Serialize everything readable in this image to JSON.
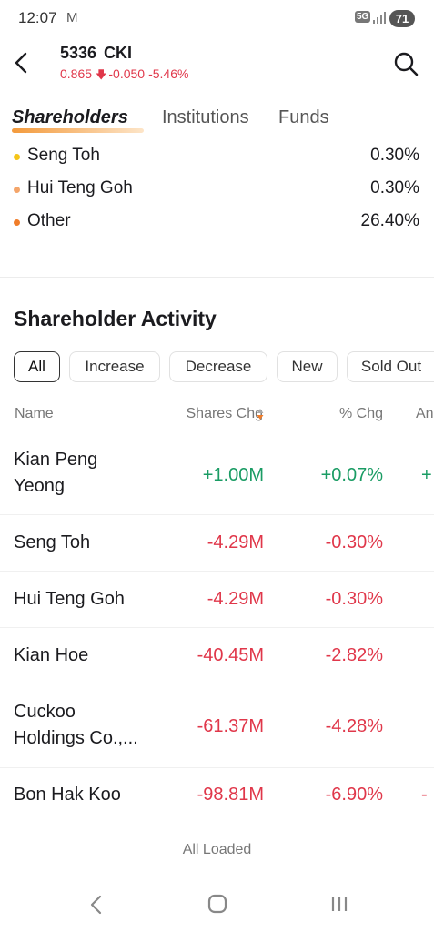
{
  "status": {
    "time": "12:07",
    "network": "5G",
    "battery": "71"
  },
  "header": {
    "code": "5336",
    "name": "CKI",
    "price": "0.865",
    "change": "-0.050",
    "change_pct": "-5.46%"
  },
  "tabs": [
    {
      "label": "Shareholders",
      "active": true
    },
    {
      "label": "Institutions",
      "active": false
    },
    {
      "label": "Funds",
      "active": false
    }
  ],
  "holders": [
    {
      "name": "Seng Toh",
      "pct": "0.30%",
      "color": "#f5c518"
    },
    {
      "name": "Hui Teng Goh",
      "pct": "0.30%",
      "color": "#f4a56a"
    },
    {
      "name": "Other",
      "pct": "26.40%",
      "color": "#f07d2a"
    }
  ],
  "activity": {
    "title": "Shareholder Activity",
    "filters": [
      "All",
      "Increase",
      "Decrease",
      "New",
      "Sold Out"
    ],
    "columns": {
      "name": "Name",
      "shares": "Shares Chg",
      "pct": "% Chg",
      "extra": "An"
    },
    "rows": [
      {
        "name": "Kian Peng Yeong",
        "shares": "+1.00M",
        "pct": "+0.07%",
        "extra": "+",
        "sign": "pos"
      },
      {
        "name": "Seng Toh",
        "shares": "-4.29M",
        "pct": "-0.30%",
        "extra": "",
        "sign": "neg"
      },
      {
        "name": "Hui Teng Goh",
        "shares": "-4.29M",
        "pct": "-0.30%",
        "extra": "",
        "sign": "neg"
      },
      {
        "name": "Kian Hoe",
        "shares": "-40.45M",
        "pct": "-2.82%",
        "extra": "",
        "sign": "neg"
      },
      {
        "name": "Cuckoo Holdings Co.,...",
        "shares": "-61.37M",
        "pct": "-4.28%",
        "extra": "",
        "sign": "neg"
      },
      {
        "name": "Bon Hak Koo",
        "shares": "-98.81M",
        "pct": "-6.90%",
        "extra": "-",
        "sign": "neg"
      }
    ],
    "footer": "All Loaded"
  }
}
